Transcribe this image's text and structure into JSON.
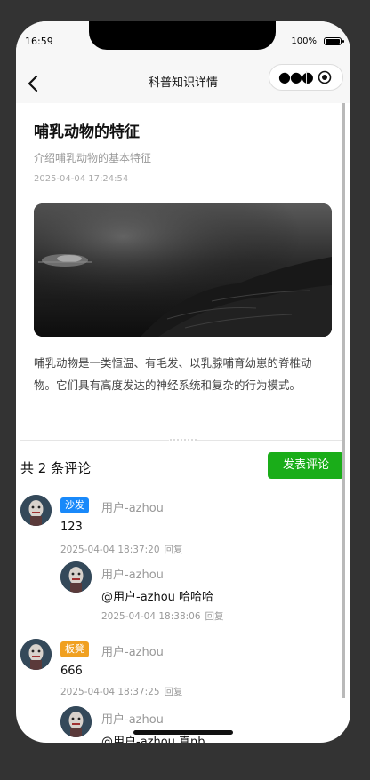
{
  "status": {
    "time": "16:59",
    "battery": "100%"
  },
  "nav": {
    "title": "科普知识详情"
  },
  "article": {
    "title": "哺乳动物的特征",
    "subtitle": "介绍哺乳动物的基本特征",
    "date": "2025-04-04 17:24:54",
    "body": "哺乳动物是一类恒温、有毛发、以乳腺哺育幼崽的脊椎动物。它们具有高度发达的神经系统和复杂的行为模式。"
  },
  "comments_header": {
    "count_text": "共 2 条评论",
    "post_button": "发表评论"
  },
  "comments": [
    {
      "badge": "沙发",
      "badge_color": "#1989fa",
      "user": "用户-azhou",
      "text": "123",
      "time": "2025-04-04 18:37:20",
      "reply": "回复",
      "reply_item": {
        "user": "用户-azhou",
        "text": "@用户-azhou 哈哈哈",
        "time": "2025-04-04 18:38:06",
        "reply": "回复"
      }
    },
    {
      "badge": "板凳",
      "badge_color": "#f0a020",
      "user": "用户-azhou",
      "text": "666",
      "time": "2025-04-04 18:37:25",
      "reply": "回复",
      "reply_item": {
        "user": "用户-azhou",
        "text": "@用户-azhou 真nb"
      }
    }
  ],
  "colors": {
    "accent_green": "#1aad19",
    "page_bg": "#333333"
  },
  "icons": [
    "back-arrow-icon",
    "more-dots-icon",
    "close-target-icon",
    "battery-icon"
  ]
}
